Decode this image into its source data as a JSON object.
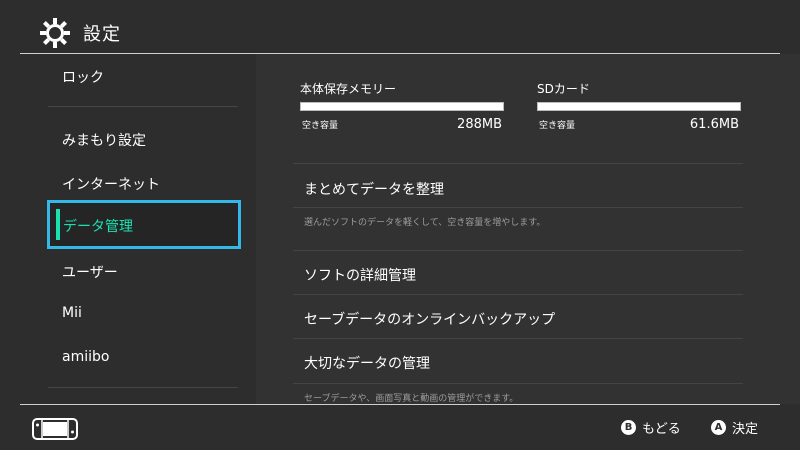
{
  "header": {
    "title": "設定",
    "icon": "gear-icon"
  },
  "sidebar": {
    "items": [
      {
        "label": "ロック"
      },
      {
        "label": "みまもり設定"
      },
      {
        "label": "インターネット"
      },
      {
        "label": "データ管理",
        "selected": true
      },
      {
        "label": "ユーザー"
      },
      {
        "label": "Mii"
      },
      {
        "label": "amiibo"
      }
    ]
  },
  "storage": {
    "internal": {
      "label": "本体保存メモリー",
      "free_label": "空き容量",
      "free_value": "288MB"
    },
    "sd": {
      "label": "SDカード",
      "free_label": "空き容量",
      "free_value": "61.6MB"
    }
  },
  "menu": {
    "items": [
      {
        "label": "まとめてデータを整理",
        "desc": "選んだソフトのデータを軽くして、空き容量を増やします。"
      },
      {
        "label": "ソフトの詳細管理"
      },
      {
        "label": "セーブデータのオンラインバックアップ"
      },
      {
        "label": "大切なデータの管理",
        "desc": "セーブデータや、画面写真と動画の管理ができます。"
      }
    ]
  },
  "footer": {
    "back": {
      "button": "B",
      "label": "もどる"
    },
    "ok": {
      "button": "A",
      "label": "決定"
    }
  },
  "colors": {
    "accent_border": "#33b8e8",
    "selected_text": "#19e3b1",
    "background": "#2d2d2d"
  }
}
